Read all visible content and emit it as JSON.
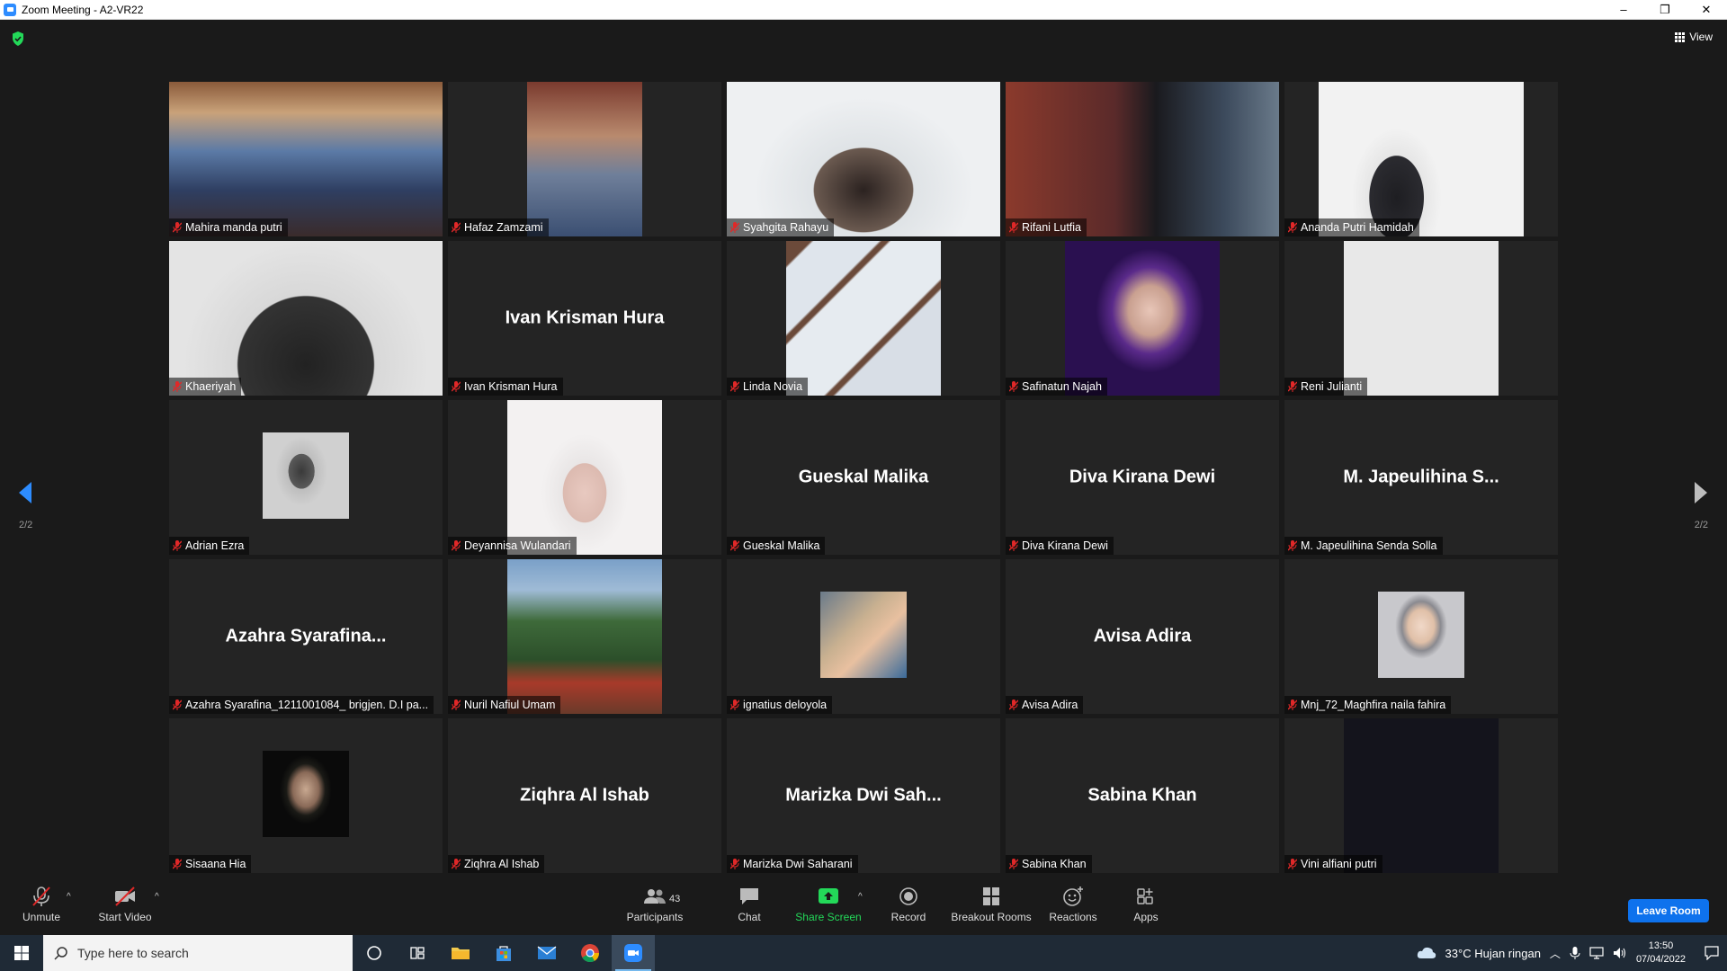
{
  "window": {
    "title": "Zoom Meeting - A2-VR22",
    "minimize": "–",
    "restore": "❐",
    "close": "✕"
  },
  "view": {
    "label": "View"
  },
  "pagination": {
    "left": "2/2",
    "right": "2/2"
  },
  "tiles": [
    {
      "label": "Mahira manda putri",
      "big": ""
    },
    {
      "label": "Hafaz Zamzami",
      "big": ""
    },
    {
      "label": "Syahgita Rahayu",
      "big": ""
    },
    {
      "label": "Rifani Lutfia",
      "big": ""
    },
    {
      "label": "Ananda Putri Hamidah",
      "big": ""
    },
    {
      "label": "Khaeriyah",
      "big": ""
    },
    {
      "label": "Ivan Krisman Hura",
      "big": "Ivan Krisman Hura"
    },
    {
      "label": "Linda Novia",
      "big": ""
    },
    {
      "label": "Safinatun Najah",
      "big": ""
    },
    {
      "label": "Reni Julianti",
      "big": ""
    },
    {
      "label": "Adrian Ezra",
      "big": ""
    },
    {
      "label": "Deyannisa Wulandari",
      "big": ""
    },
    {
      "label": "Gueskal Malika",
      "big": "Gueskal Malika"
    },
    {
      "label": "Diva Kirana Dewi",
      "big": "Diva Kirana Dewi"
    },
    {
      "label": "M. Japeulihina Senda Solla",
      "big": "M. Japeulihina S..."
    },
    {
      "label": "Azahra Syarafina_1211001084_ brigjen. D.I pa...",
      "big": "Azahra  Syarafina..."
    },
    {
      "label": "Nuril Nafiul Umam",
      "big": ""
    },
    {
      "label": "ignatius deloyola",
      "big": ""
    },
    {
      "label": "Avisa Adira",
      "big": "Avisa Adira"
    },
    {
      "label": "Mnj_72_Maghfira naila fahira",
      "big": ""
    },
    {
      "label": "Sisaana Hia",
      "big": ""
    },
    {
      "label": "Ziqhra Al Ishab",
      "big": "Ziqhra Al Ishab"
    },
    {
      "label": "Marizka Dwi Saharani",
      "big": "Marizka Dwi Sah..."
    },
    {
      "label": "Sabina Khan",
      "big": "Sabina Khan"
    },
    {
      "label": "Vini alfiani putri",
      "big": ""
    }
  ],
  "toolbar": {
    "unmute": "Unmute",
    "start_video": "Start Video",
    "participants": "Participants",
    "participants_count": "43",
    "chat": "Chat",
    "share_screen": "Share Screen",
    "record": "Record",
    "breakout_rooms": "Breakout Rooms",
    "reactions": "Reactions",
    "apps": "Apps",
    "leave": "Leave Room",
    "caret": "^"
  },
  "taskbar": {
    "search_placeholder": "Type here to search",
    "weather": "33°C  Hujan ringan",
    "time": "13:50",
    "date": "07/04/2022"
  },
  "colors": {
    "accent": "#0e72ed",
    "share_green": "#23d959",
    "muted_red": "#e02828"
  }
}
